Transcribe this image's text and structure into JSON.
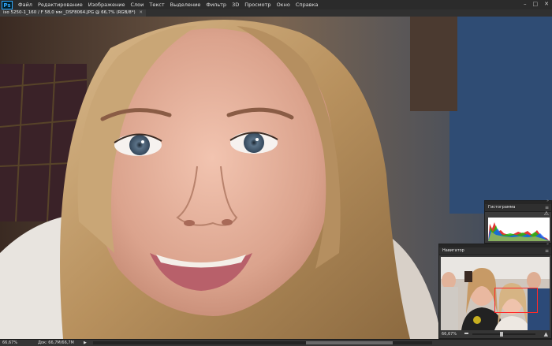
{
  "app": {
    "logo": "Ps",
    "menu": [
      "Файл",
      "Редактирование",
      "Изображение",
      "Слои",
      "Текст",
      "Выделение",
      "Фильтр",
      "3D",
      "Просмотр",
      "Окно",
      "Справка"
    ],
    "window_controls": {
      "minimize": "–",
      "maximize": "□",
      "close": "✕"
    }
  },
  "document": {
    "tab_title": "iso 5250-1_160 / F 58,0 мм _DSF8064.JPG @ 66,7% (RGB/8*)",
    "close_glyph": "✕"
  },
  "status": {
    "zoom": "66,67%",
    "doc_size": "Док: 66,7M/66,7M",
    "arrow": "▶"
  },
  "histogram_panel": {
    "title": "Гистограмма",
    "menu_icon": "≡",
    "collapse": "»",
    "warning": "⚠",
    "shape": "multi-channel RGB histogram, peaks concentrated in midtones and shadows"
  },
  "navigator_panel": {
    "title": "Навигатор",
    "menu_icon": "≡",
    "collapse": "»",
    "zoom_value": "66,67%",
    "zoom_fraction": 0.6667,
    "plus_glyph": "▲",
    "view_box_color": "#ff2a2a"
  },
  "colors": {
    "chrome": "#2b2b2b",
    "panel": "#3b3b3b",
    "accent_ps": "#31a8ff"
  },
  "icons": [
    "ps-logo-icon",
    "close-icon",
    "warning-icon",
    "panel-menu-icon",
    "collapse-icon",
    "zoom-in-icon",
    "zoom-out-icon"
  ]
}
